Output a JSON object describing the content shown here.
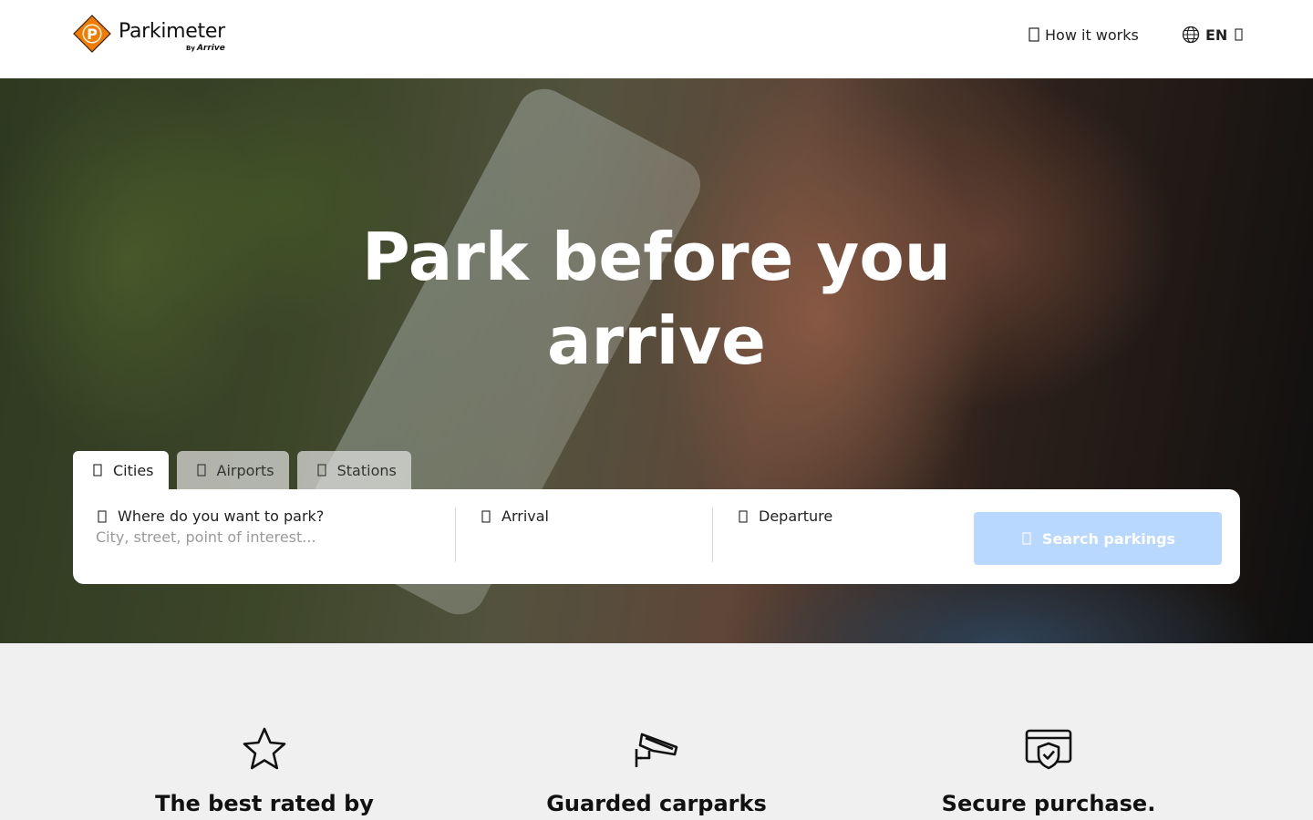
{
  "header": {
    "logo_title": "Parkimeter",
    "logo_by": "By",
    "logo_brand": "Arrive",
    "how_it_works": "How it works",
    "language": "EN"
  },
  "hero": {
    "title": "Park before you arrive"
  },
  "tabs": [
    {
      "label": "Cities",
      "active": true
    },
    {
      "label": "Airports",
      "active": false
    },
    {
      "label": "Stations",
      "active": false
    }
  ],
  "search": {
    "where_label": "Where do you want to park?",
    "where_placeholder": "City, street, point of interest...",
    "arrival_label": "Arrival",
    "departure_label": "Departure",
    "button_label": "Search parkings"
  },
  "features": [
    {
      "title": "The best rated by",
      "icon": "star-icon"
    },
    {
      "title": "Guarded carparks",
      "icon": "security-camera-icon"
    },
    {
      "title": "Secure purchase.",
      "icon": "secure-card-icon"
    }
  ],
  "colors": {
    "brand_orange": "#f07d00",
    "search_button": "#b9d8ff",
    "features_bg": "#f0f0f0"
  }
}
